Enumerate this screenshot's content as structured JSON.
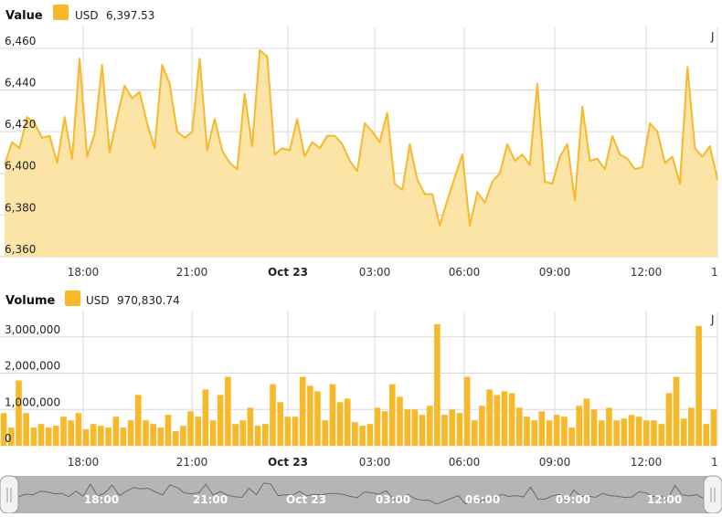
{
  "colors": {
    "accent": "#F7B82A",
    "accent_fill": "#FCE3A6",
    "grid": "#d9d9d9",
    "navigator_bg": "#b5b5b5"
  },
  "chart_data": [
    {
      "type": "area",
      "title": "Value",
      "legend": [
        {
          "name": "USD",
          "value": "6,397.53"
        }
      ],
      "ylim": [
        6360,
        6470
      ],
      "y_ticks": [
        "6,460",
        "6,440",
        "6,420",
        "6,400",
        "6,380",
        "6,360"
      ],
      "x_ticks": [
        "18:00",
        "21:00",
        "Oct 23",
        "03:00",
        "06:00",
        "09:00",
        "12:00",
        "1"
      ],
      "grid": true,
      "series": [
        {
          "values": [
            6404,
            6415,
            6412,
            6427,
            6424,
            6417,
            6418,
            6405,
            6427,
            6407,
            6455,
            6408,
            6419,
            6452,
            6410,
            6427,
            6442,
            6436,
            6439,
            6424,
            6412,
            6452,
            6443,
            6420,
            6417,
            6420,
            6455,
            6411,
            6426,
            6411,
            6405,
            6402,
            6438,
            6413,
            6459,
            6456,
            6409,
            6412,
            6411,
            6426,
            6408,
            6415,
            6412,
            6418,
            6418,
            6414,
            6406,
            6401,
            6424,
            6420,
            6415,
            6429,
            6395,
            6392,
            6414,
            6397,
            6390,
            6390,
            6375,
            6387,
            6398,
            6409,
            6375,
            6391,
            6386,
            6396,
            6400,
            6414,
            6406,
            6409,
            6404,
            6443,
            6396,
            6395,
            6408,
            6414,
            6387,
            6432,
            6406,
            6407,
            6402,
            6418,
            6409,
            6407,
            6402,
            6403,
            6424,
            6420,
            6405,
            6408,
            6395,
            6451,
            6412,
            6408,
            6413,
            6397
          ]
        }
      ]
    },
    {
      "type": "bar",
      "title": "Volume",
      "legend": [
        {
          "name": "USD",
          "value": "970,830.74"
        }
      ],
      "ylim": [
        0,
        3700000
      ],
      "y_ticks": [
        "3,000,000",
        "2,000,000",
        "1,000,000",
        "0"
      ],
      "x_ticks": [
        "18:00",
        "21:00",
        "Oct 23",
        "03:00",
        "06:00",
        "09:00",
        "12:00",
        "1"
      ],
      "grid": true,
      "series": [
        {
          "values": [
            900000,
            500000,
            1800000,
            900000,
            500000,
            600000,
            500000,
            550000,
            800000,
            700000,
            900000,
            450000,
            600000,
            550000,
            500000,
            800000,
            500000,
            700000,
            1400000,
            700000,
            600000,
            500000,
            850000,
            400000,
            550000,
            950000,
            800000,
            1550000,
            700000,
            1400000,
            1900000,
            600000,
            700000,
            1050000,
            550000,
            600000,
            1700000,
            1200000,
            800000,
            800000,
            1900000,
            1650000,
            1500000,
            700000,
            1700000,
            1200000,
            1300000,
            650000,
            550000,
            600000,
            1050000,
            950000,
            1700000,
            1350000,
            1000000,
            1000000,
            850000,
            1100000,
            3350000,
            850000,
            1000000,
            900000,
            1900000,
            700000,
            1100000,
            1550000,
            1400000,
            1500000,
            1450000,
            1050000,
            800000,
            700000,
            950000,
            700000,
            850000,
            800000,
            500000,
            1100000,
            1300000,
            1000000,
            700000,
            1050000,
            700000,
            750000,
            850000,
            800000,
            700000,
            700000,
            600000,
            1450000,
            1900000,
            750000,
            1050000,
            3300000,
            600000,
            1000000
          ]
        }
      ]
    }
  ],
  "navigator": {
    "labels": [
      "18:00",
      "21:00",
      "Oct 23",
      "03:00",
      "06:00",
      "09:00",
      "12:00"
    ]
  }
}
